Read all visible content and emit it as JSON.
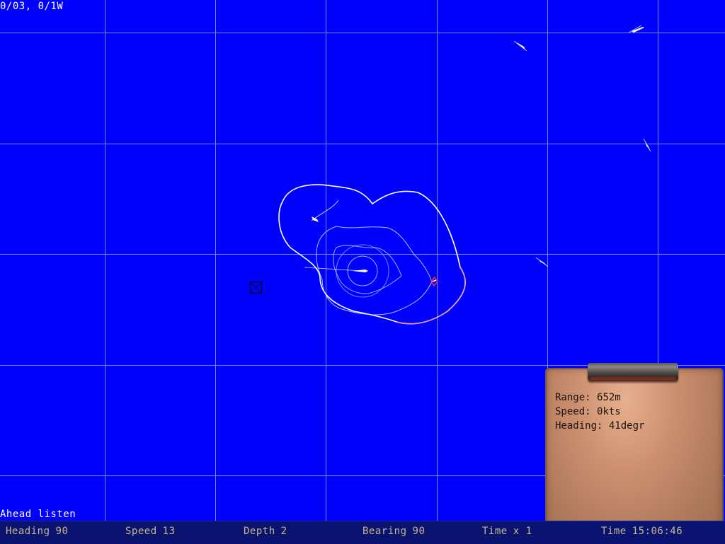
{
  "map": {
    "coordinates": "0/03, 0/1W",
    "grid_color": "#8aa0ff",
    "sea_color": "#0000ff",
    "coastline_color": "#ffffff",
    "icons": [
      "ship-icon",
      "waypoint-icon",
      "target-marker-icon"
    ]
  },
  "status_message": "Ahead listen",
  "status_bar": {
    "heading_label": "Heading",
    "heading_value": "90",
    "speed_label": "Speed",
    "speed_value": "13",
    "depth_label": "Depth",
    "depth_value": "2",
    "bearing_label": "Bearing",
    "bearing_value": "90",
    "time_compression_label": "Time",
    "time_compression_value": "x 1",
    "clock_label": "Time",
    "clock_value": "15:06:46"
  },
  "target_info": {
    "range_label": "Range:",
    "range_value": "652m",
    "speed_label": "Speed:",
    "speed_value": "0kts",
    "heading_label": "Heading:",
    "heading_value": "41degr"
  }
}
